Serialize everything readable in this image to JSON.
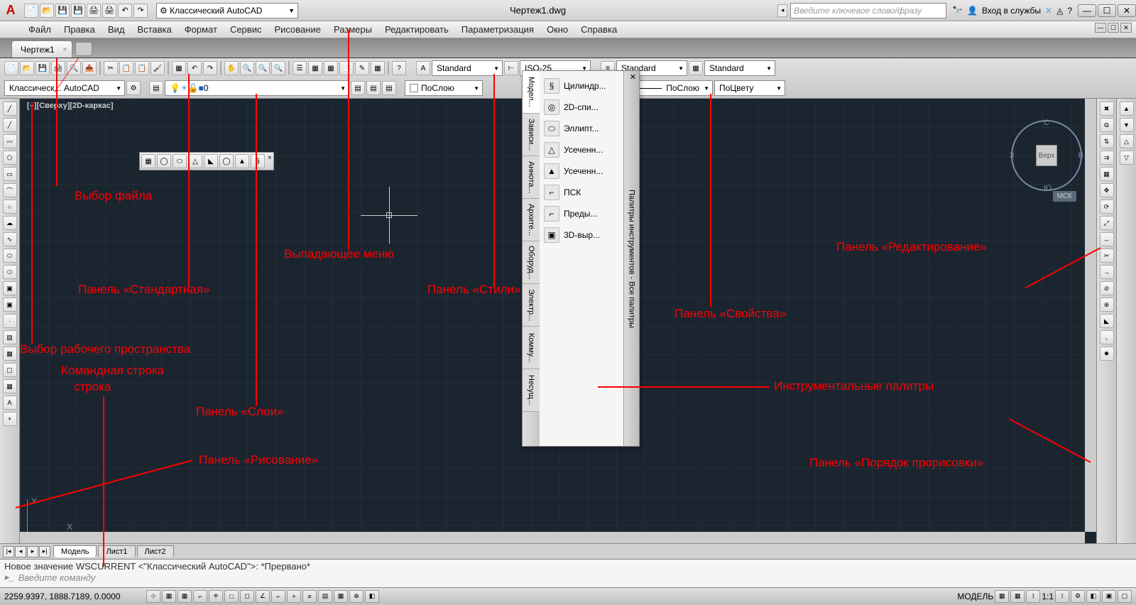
{
  "app": {
    "logo": "A",
    "workspace": "Классический AutoCAD",
    "doc_title": "Чертеж1.dwg",
    "search_placeholder": "Введите ключевое слово/фразу",
    "signin": "Вход в службы"
  },
  "menu": [
    "Файл",
    "Правка",
    "Вид",
    "Вставка",
    "Формат",
    "Сервис",
    "Рисование",
    "Размеры",
    "Редактировать",
    "Параметризация",
    "Окно",
    "Справка"
  ],
  "filetab": {
    "name": "Чертеж1"
  },
  "styles": {
    "text": "Standard",
    "dim": "ISO-25",
    "ml": "Standard",
    "table": "Standard"
  },
  "layers": {
    "current": "0",
    "layer_label": "0",
    "workspace_label": "Классическ... AutoCAD"
  },
  "props": {
    "bylayer1": "ПоСлою",
    "bylayer2": "ПоСлою",
    "bycolor": "ПоЦвету"
  },
  "canvas": {
    "label": "[–][Сверху][2D-каркас]",
    "viewcube_top": "Верх",
    "dir_n": "С",
    "dir_s": "Ю",
    "dir_e": "В",
    "dir_w": "З",
    "mck": "МСК"
  },
  "palette": {
    "title": "Палитры инструментов - Все палитры",
    "tabs": [
      "Модел...",
      "Зависи...",
      "Аннота...",
      "Архите...",
      "Оборуд...",
      "Электр...",
      "Комму...",
      "Несущ..."
    ],
    "items": [
      "Цилиндр...",
      "2D-спи...",
      "Эллипт...",
      "Усеченн...",
      "Усеченн...",
      "ПСК",
      "Преды...",
      "3D-выр..."
    ]
  },
  "layout": {
    "model": "Модель",
    "sheet1": "Лист1",
    "sheet2": "Лист2"
  },
  "cmd": {
    "history": "Новое значение WSCURRENT <\"Классический AutoCAD\">: *Прервано*",
    "prompt": "Введите команду"
  },
  "status": {
    "coords": "2259.9397, 1888.7189, 0.0000",
    "model": "МОДЕЛЬ",
    "scale": "1:1"
  },
  "annotations": {
    "file_choice": "Выбор файла",
    "dropdown_menu": "Выпадающее меню",
    "standard_panel": "Панель «Стандартная»",
    "styles_panel": "Панель «Стили»",
    "layers_panel": "Панель «Слои»",
    "workspace_choice": "Выбор рабочего пространства",
    "cmd_line": "Командная строка",
    "draw_panel": "Панель «Рисование»",
    "props_panel": "Панель «Свойства»",
    "edit_panel": "Панель «Редактирование»",
    "palettes": "Инструментальные палитры",
    "draworder_panel": "Панель «Порядок прорисовки»"
  }
}
